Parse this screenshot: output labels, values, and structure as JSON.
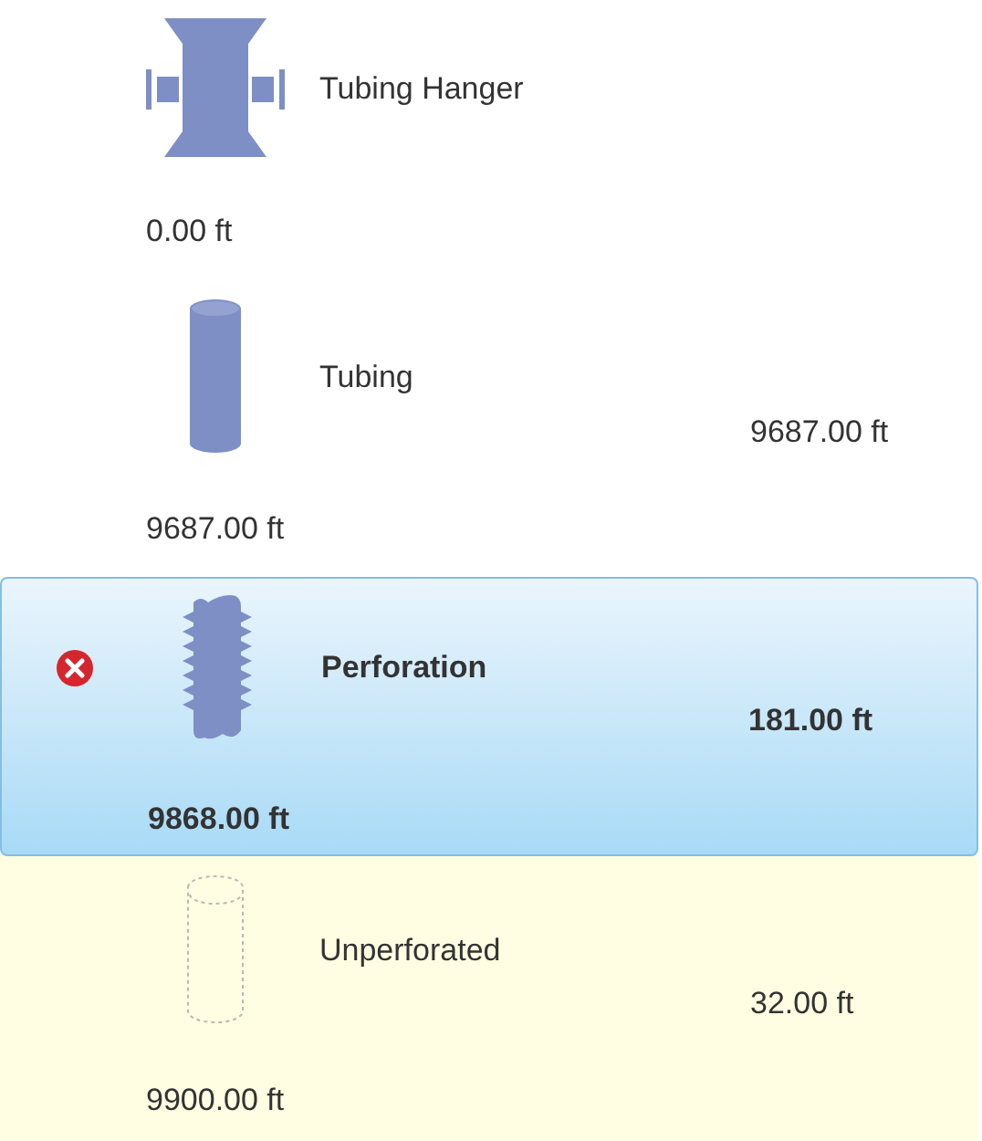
{
  "components": [
    {
      "kind": "hanger",
      "name": "Tubing Hanger",
      "depth": "0.00 ft",
      "selected": false,
      "error": false,
      "highlighted": false
    },
    {
      "kind": "tubing",
      "name": "Tubing",
      "length": "9687.00 ft",
      "depth": "9687.00 ft",
      "selected": false,
      "error": false,
      "highlighted": false
    },
    {
      "kind": "perforation",
      "name": "Perforation",
      "length": "181.00 ft",
      "depth": "9868.00 ft",
      "selected": true,
      "error": true,
      "highlighted": false
    },
    {
      "kind": "unperforated",
      "name": "Unperforated",
      "length": "32.00 ft",
      "depth": "9900.00 ft",
      "selected": false,
      "error": false,
      "highlighted": true
    }
  ]
}
